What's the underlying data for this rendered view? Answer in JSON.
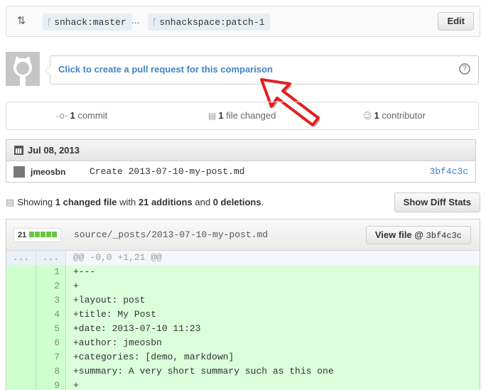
{
  "compare": {
    "base_branch": "snhack:master",
    "head_branch": "snhackspace:patch-1",
    "ellipsis": "...",
    "edit_label": "Edit"
  },
  "pull_request": {
    "link_text": "Click to create a pull request for this comparison",
    "help_symbol": "?"
  },
  "stats": {
    "commits": {
      "count": "1",
      "label": "commit"
    },
    "files": {
      "count": "1",
      "label": "file changed"
    },
    "contributors": {
      "count": "1",
      "label": "contributor"
    }
  },
  "commit_group": {
    "date": "Jul 08, 2013",
    "commits": [
      {
        "author": "jmeosbn",
        "message": "Create 2013-07-10-my-post.md",
        "sha": "3bf4c3c"
      }
    ]
  },
  "summary": {
    "prefix": "Showing",
    "files_changed": "1 changed file",
    "with": "with",
    "additions": "21 additions",
    "and": "and",
    "deletions": "0 deletions",
    "suffix": "."
  },
  "show_diff_stats_label": "Show Diff Stats",
  "file": {
    "diff_count": "21",
    "path": "source/_posts/2013-07-10-my-post.md",
    "view_label": "View file @",
    "view_sha": "3bf4c3c",
    "hunk": {
      "left": "...",
      "right": "...",
      "text": "@@ -0,0 +1,21 @@"
    },
    "lines": [
      {
        "num": "1",
        "text": "+---"
      },
      {
        "num": "2",
        "text": "+"
      },
      {
        "num": "3",
        "text": "+layout: post"
      },
      {
        "num": "4",
        "text": "+title: My Post"
      },
      {
        "num": "5",
        "text": "+date: 2013-07-10 11:23"
      },
      {
        "num": "6",
        "text": "+author: jmeosbn"
      },
      {
        "num": "7",
        "text": "+categories: [demo, markdown]"
      },
      {
        "num": "8",
        "text": "+summary: A very short summary such as this one"
      },
      {
        "num": "9",
        "text": "+"
      }
    ]
  },
  "colors": {
    "link": "#4183c4",
    "addition_bg": "#dbffdb",
    "addition_bar": "#6cc644",
    "annotation_arrow": "#e02020"
  }
}
